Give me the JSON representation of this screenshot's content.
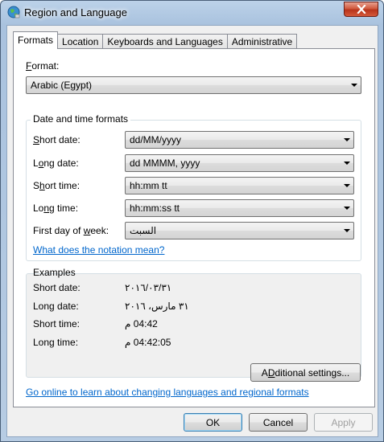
{
  "window": {
    "title": "Region and Language"
  },
  "tabs": [
    {
      "label": "Formats",
      "active": true
    },
    {
      "label": "Location",
      "active": false
    },
    {
      "label": "Keyboards and Languages",
      "active": false
    },
    {
      "label": "Administrative",
      "active": false
    }
  ],
  "format": {
    "label_accel": "F",
    "label_rest": "ormat:",
    "value": "Arabic (Egypt)"
  },
  "date_time_formats": {
    "title": "Date and time formats",
    "short_date": {
      "label_accel": "S",
      "label_rest": "hort date:",
      "value": "dd/MM/yyyy"
    },
    "long_date": {
      "label_pre": "L",
      "label_accel": "o",
      "label_rest": "ng date:",
      "value": "dd MMMM, yyyy"
    },
    "short_time": {
      "label_pre": "S",
      "label_accel": "h",
      "label_rest": "ort time:",
      "value": "hh:mm tt"
    },
    "long_time": {
      "label_pre": "Lo",
      "label_accel": "n",
      "label_rest": "g time:",
      "value": "hh:mm:ss tt"
    },
    "first_day": {
      "label_pre": "First day of ",
      "label_accel": "w",
      "label_rest": "eek:",
      "value": "السبت"
    },
    "notation_link": "What does the notation mean?"
  },
  "examples": {
    "title": "Examples",
    "short_date_label": "Short date:",
    "short_date_value": "٢٠١٦/٠٣/٣١",
    "long_date_label": "Long date:",
    "long_date_value": "٣١ مارس، ٢٠١٦",
    "short_time_label": "Short time:",
    "short_time_value": "04:42 م",
    "long_time_label": "Long time:",
    "long_time_value": "04:42:05 م"
  },
  "additional_settings": {
    "label_accel": "D",
    "label_pre": "A",
    "label_rest": "ditional settings..."
  },
  "online_link": "Go online to learn about changing languages and regional formats",
  "buttons": {
    "ok": "OK",
    "cancel": "Cancel",
    "apply": "Apply"
  },
  "colors": {
    "link": "#0066cc",
    "close": "#c8432a",
    "frame": "#a9c2de"
  }
}
